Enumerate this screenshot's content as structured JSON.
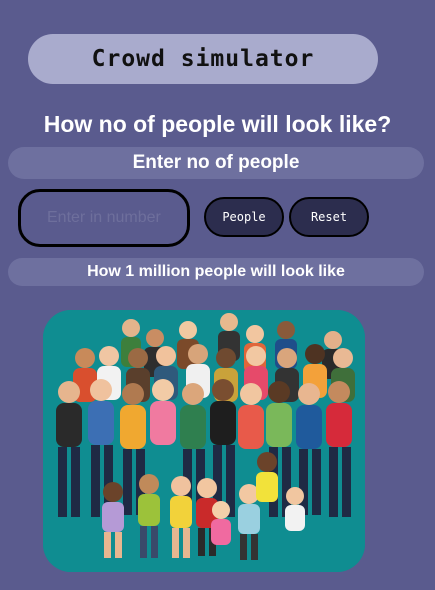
{
  "app": {
    "title": "Crowd simulator"
  },
  "main": {
    "heading": "How no of people will look like?",
    "prompt_label": "Enter no of people",
    "input": {
      "value": "",
      "placeholder": "Enter in number"
    },
    "buttons": {
      "people": "People",
      "reset": "Reset"
    },
    "result_label": "How 1 million people will look like"
  },
  "image": {
    "subject": "crowd-illustration",
    "background_color": "#0f8d91"
  },
  "colors": {
    "page_bg": "#5a5b8e",
    "pill": "#a9abcd",
    "bar": "#6e709f",
    "button": "#2c2d4e"
  }
}
